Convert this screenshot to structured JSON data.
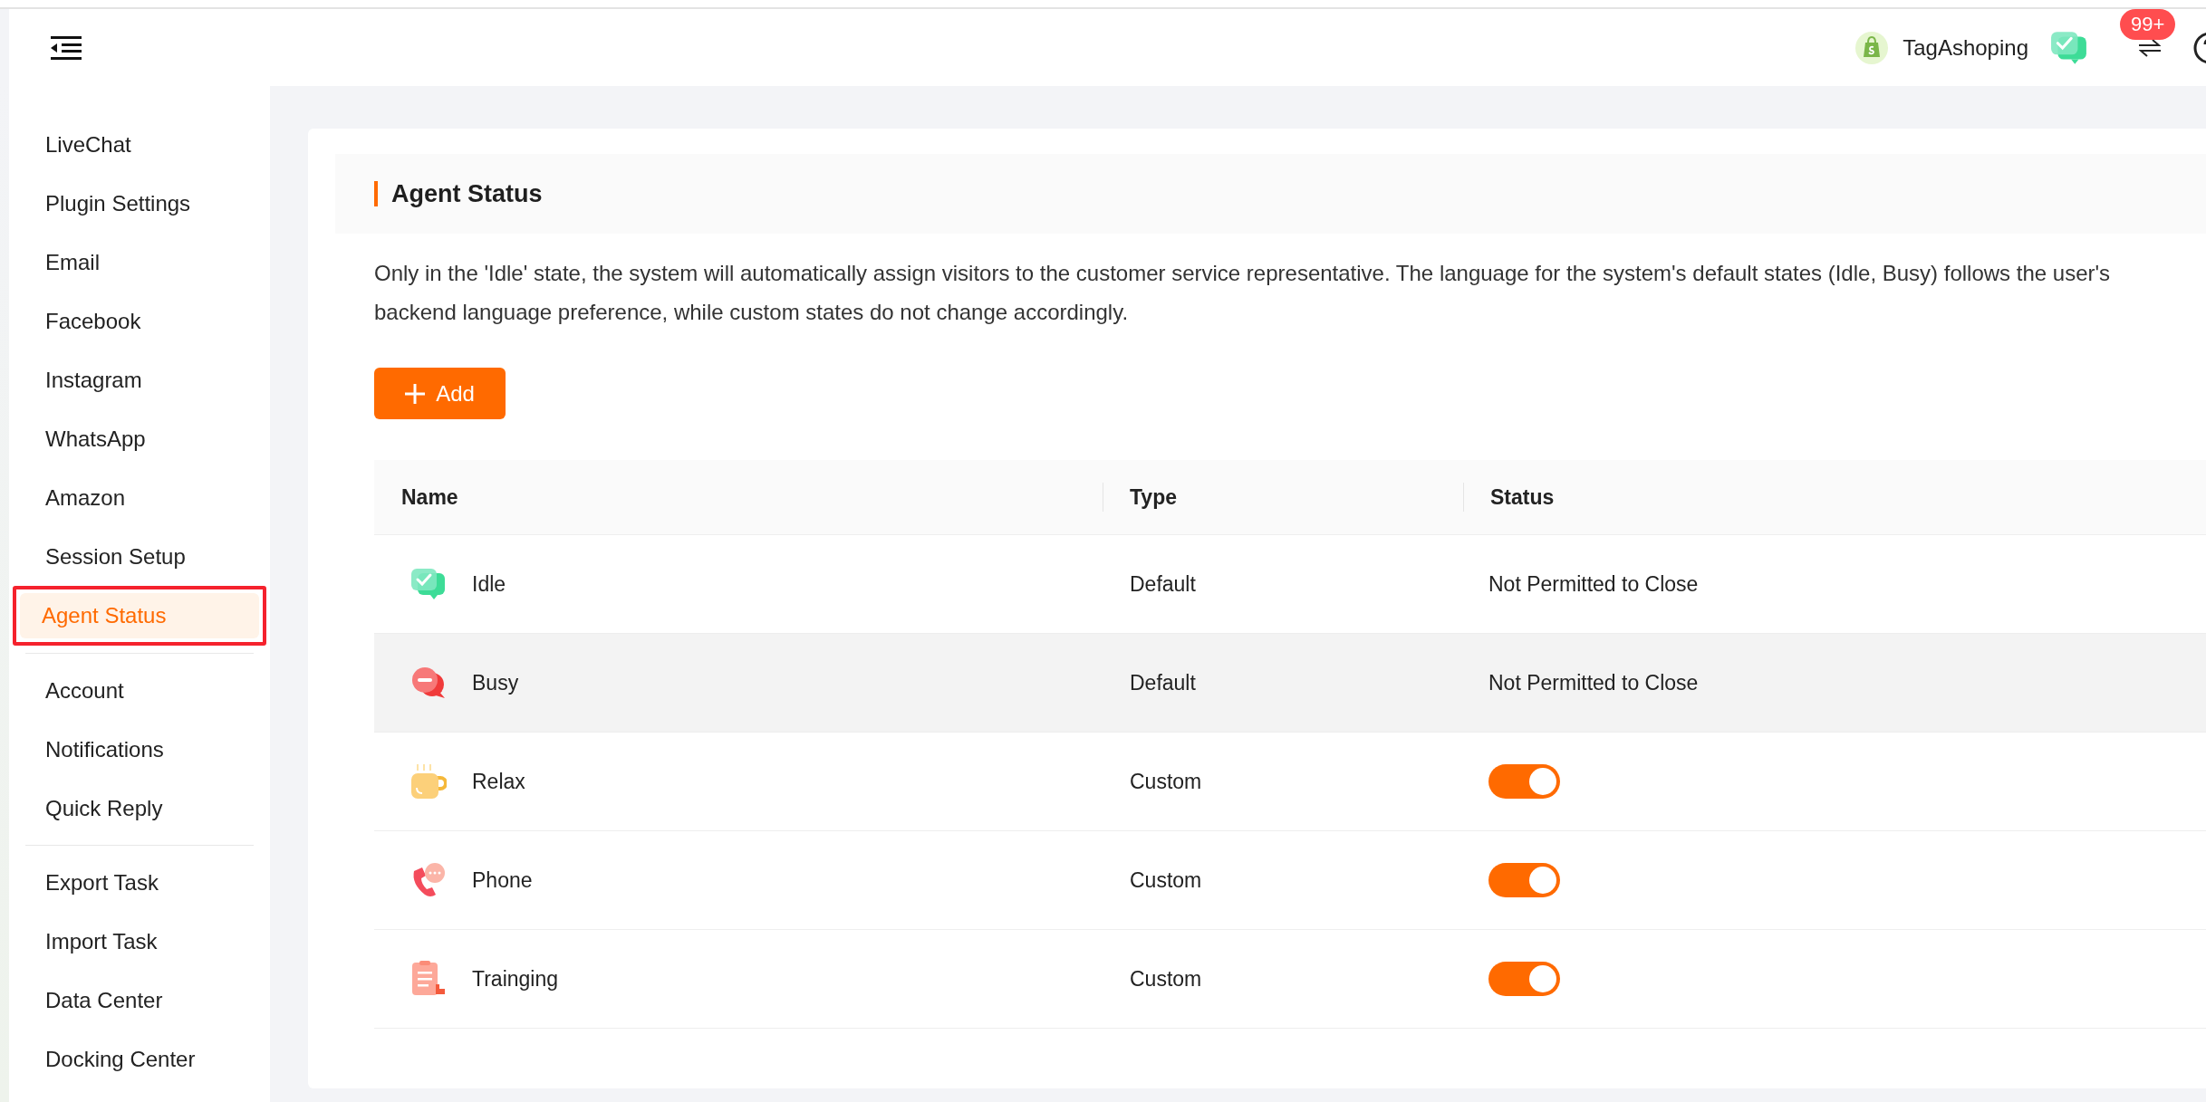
{
  "header": {
    "shop_name": "TagAshoping",
    "badge": "99+"
  },
  "sidebar": {
    "groups": [
      [
        {
          "label": "LiveChat",
          "selected": false
        },
        {
          "label": "Plugin Settings",
          "selected": false
        },
        {
          "label": "Email",
          "selected": false
        },
        {
          "label": "Facebook",
          "selected": false
        },
        {
          "label": "Instagram",
          "selected": false
        },
        {
          "label": "WhatsApp",
          "selected": false
        },
        {
          "label": "Amazon",
          "selected": false
        },
        {
          "label": "Session Setup",
          "selected": false
        },
        {
          "label": "Agent Status",
          "selected": true
        }
      ],
      [
        {
          "label": "Account",
          "selected": false
        },
        {
          "label": "Notifications",
          "selected": false
        },
        {
          "label": "Quick Reply",
          "selected": false
        }
      ],
      [
        {
          "label": "Export Task",
          "selected": false
        },
        {
          "label": "Import Task",
          "selected": false
        },
        {
          "label": "Data Center",
          "selected": false
        },
        {
          "label": "Docking Center",
          "selected": false
        }
      ]
    ]
  },
  "section": {
    "title": "Agent Status",
    "description": "Only in the 'Idle' state, the system will automatically assign visitors to the customer service representative. The language for the system's default states (Idle, Busy) follows the user's backend language preference, while custom states do not change accordingly.",
    "add_button": "Add"
  },
  "table": {
    "columns": [
      "Name",
      "Type",
      "Status"
    ],
    "rows": [
      {
        "name": "Idle",
        "type": "Default",
        "kind": "text",
        "status": "Not Permitted to Close",
        "hovered": false
      },
      {
        "name": "Busy",
        "type": "Default",
        "kind": "text",
        "status": "Not Permitted to Close",
        "hovered": true
      },
      {
        "name": "Relax",
        "type": "Custom",
        "kind": "toggle",
        "on": true,
        "hovered": false
      },
      {
        "name": "Phone",
        "type": "Custom",
        "kind": "toggle",
        "on": true,
        "hovered": false
      },
      {
        "name": "Trainging",
        "type": "Custom",
        "kind": "toggle",
        "on": true,
        "hovered": false
      }
    ]
  }
}
